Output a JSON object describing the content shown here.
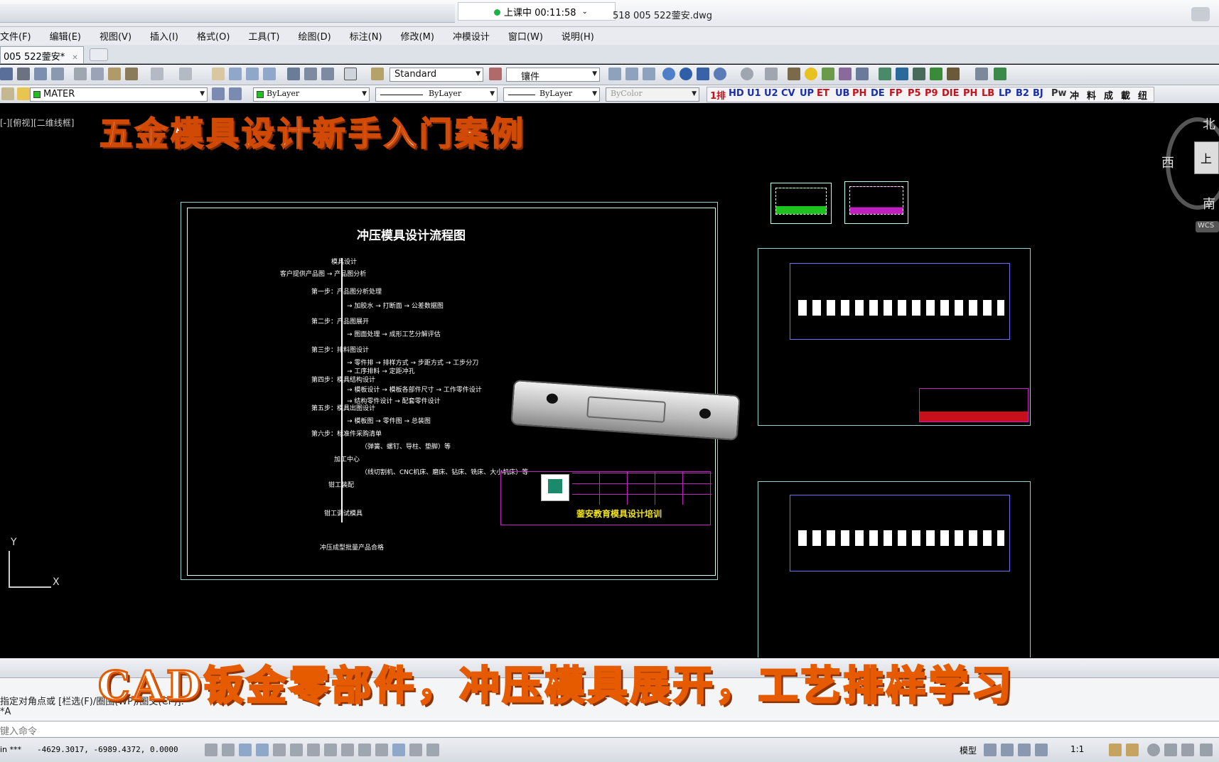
{
  "titlebar": {
    "timer": "上课中 00:11:58",
    "file_title": "518 005 522蓥安.dwg"
  },
  "menu": [
    "文件(F)",
    "编辑(E)",
    "视图(V)",
    "插入(I)",
    "格式(O)",
    "工具(T)",
    "绘图(D)",
    "标注(N)",
    "修改(M)",
    "冲模设计",
    "窗口(W)",
    "说明(H)"
  ],
  "tab": {
    "label": "005 522蓥安*",
    "close": "✕"
  },
  "toolbar": {
    "text_style": "Standard",
    "dim_style": "镶件",
    "layer": "MATER",
    "color": "ByLayer",
    "linetype": "ByLayer",
    "lineweight": "ByLayer",
    "plotstyle": "ByColor",
    "custom_buttons": [
      "1排",
      "HD",
      "U1",
      "U2",
      "CV",
      "UP",
      "ET",
      "UB",
      "PH",
      "DE",
      "FP",
      "P5",
      "P9",
      "DIE",
      "PH",
      "LB",
      "LP",
      "B2",
      "BJ",
      "Pw",
      "冲",
      "料",
      "成",
      "載",
      "纽"
    ]
  },
  "viewport_label": "[-][俯视][二维线框]",
  "overlay": {
    "top_title": "五金模具设计新手入门案例",
    "bottom_caption": "CAD钣金零部件，冲压模具展开，工艺排样学习"
  },
  "viewcube": {
    "north": "北",
    "west": "西",
    "south": "南",
    "top": "上",
    "wcs": "WCS"
  },
  "flowchart": {
    "title": "冲压模具设计流程图",
    "steps": [
      "模具设计",
      "客户提供产品图 → 产品图分析",
      "第一步：产品图分析处理",
      "→ 加胶水 → 打断面 → 公差数据图",
      "第二步：产品图展开",
      "→ 图面处理 → 成形工艺分解评估",
      "第三步：排料图设计",
      "→ 零件排 → 排样方式 → 步距方式 → 工步分刀",
      "→ 工序排料 → 定距冲孔",
      "第四步：模具结构设计",
      "→ 模板设计 → 模板各部件尺寸 → 工作零件设计",
      "→ 结构零件设计 → 配套零件设计",
      "第五步：模具出图设计",
      "→ 模板图 → 零件图 → 总装图",
      "第六步：标准件采购清单",
      "（弹簧、螺钉、导柱、垫脚）等",
      "加工中心",
      "（线切割机、CNC机床、磨床、钻床、铣床、大小机床）等",
      "钳工装配",
      "钳工调试模具",
      "冲压成型批量产品合格"
    ],
    "titleblock": "蓥安教育模具设计培训"
  },
  "axis": {
    "y": "Y",
    "x": "X"
  },
  "command": {
    "line1": "指定对角点或 [栏选(F)/圈围(WP)/圈交(CP)]:",
    "line2": "*A",
    "prompt": "键入命令"
  },
  "status": {
    "coords": "-4629.3017, -6989.4372, 0.0000",
    "model": "模型",
    "scale": "1:1",
    "left_label": "in ***"
  }
}
